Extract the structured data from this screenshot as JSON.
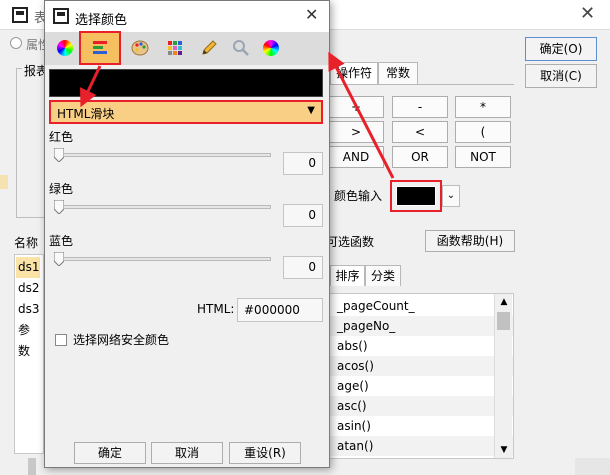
{
  "background_window": {
    "title_partial": "表",
    "radio_partial": "属性",
    "group_partial": "报表",
    "ok_button": "确定(O)",
    "cancel_button": "取消(C)",
    "tabs": [
      "操作符",
      "常数"
    ],
    "operators": [
      "+",
      "-",
      "*",
      ">",
      "<",
      "(",
      "AND",
      "OR",
      "NOT"
    ],
    "color_input_label": "颜色输入",
    "color_input_value": "#000000",
    "optional_function_label": "可选函数",
    "function_help_button": "函数帮助(H)",
    "name_label": "名称",
    "name_items": [
      "ds1",
      "ds2",
      "ds3",
      "参数"
    ],
    "function_tabs": [
      "排序",
      "分类"
    ],
    "functions": [
      "_pageCount_",
      "_pageNo_",
      "abs()",
      "acos()",
      "age()",
      "asc()",
      "asin()",
      "atan()"
    ]
  },
  "dialog": {
    "title": "选择颜色",
    "toolbar_icons": [
      "color-wheel-icon",
      "html-sliders-icon",
      "palette-icon",
      "swatches-icon",
      "pencil-icon",
      "magnifier-icon",
      "color-wheel-icon"
    ],
    "preview_color": "#000000",
    "mode_select": {
      "value": "HTML滑块"
    },
    "sliders": [
      {
        "label": "红色",
        "value": "0"
      },
      {
        "label": "绿色",
        "value": "0"
      },
      {
        "label": "蓝色",
        "value": "0"
      }
    ],
    "html_label": "HTML:",
    "html_value": "#000000",
    "web_safe_label": "选择网络安全颜色",
    "buttons": {
      "ok": "确定",
      "cancel": "取消",
      "reset": "重设(R)"
    }
  },
  "colors": {
    "highlight": "#e8202a",
    "select_bg": "#f9cf86",
    "preview": "#000000"
  }
}
